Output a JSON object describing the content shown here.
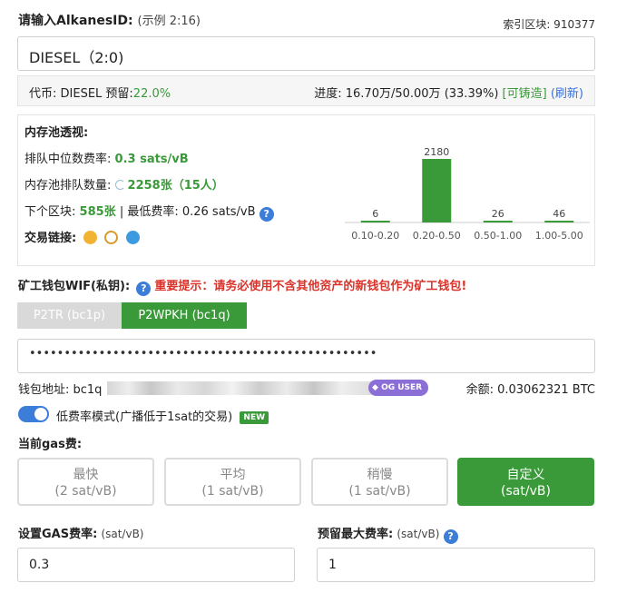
{
  "header": {
    "title": "请输入AlkanesID:",
    "example": "(示例 2:16)",
    "block_index": "索引区块: 910377"
  },
  "id_input": {
    "value": "DIESEL（2:0)"
  },
  "token": {
    "label": "代币: DIESEL 预留:",
    "reserve": "22.0%",
    "progress_label": "进度: 16.70万/50.00万 (33.39%)",
    "mintable": "[可铸造]",
    "refresh": "(刷新)"
  },
  "mempool": {
    "title": "内存池透视:",
    "median_label": "排队中位数费率:",
    "median_value": "0.3 sats/vB",
    "queue_label": "内存池排队数量:",
    "queue_value": "2258张（15人）",
    "next_block_label": "下个区块:",
    "next_block_value": "585张",
    "min_fee_label": "| 最低费率: 0.26 sats/vB",
    "links_label": "交易链接:"
  },
  "chart_data": {
    "type": "bar",
    "categories": [
      "0.10-0.20",
      "0.20-0.50",
      "0.50-1.00",
      "1.00-5.00"
    ],
    "values": [
      6,
      2180,
      26,
      46
    ],
    "ylim": [
      0,
      2180
    ],
    "bar_color": "#3a9a3a"
  },
  "wallet": {
    "wif_label": "矿工钱包WIF(私钥):",
    "warning": "重要提示：请务必使用不含其他资产的新钱包作为矿工钱包!",
    "tab_p2tr": "P2TR (bc1p)",
    "tab_p2wpkh": "P2WPKH (bc1q)",
    "wif_value": "••••••••••••••••••••••••••••••••••••••••••••••••••",
    "address_label": "钱包地址: bc1q",
    "og_badge": "OG USER",
    "balance": "余额: 0.03062321 BTC"
  },
  "low_fee": {
    "label": "低费率模式(广播低于1sat的交易)",
    "badge": "NEW"
  },
  "gas": {
    "title": "当前gas费:",
    "options": [
      {
        "name": "最快",
        "rate": "(2 sat/vB)"
      },
      {
        "name": "平均",
        "rate": "(1 sat/vB)"
      },
      {
        "name": "稍慢",
        "rate": "(1 sat/vB)"
      },
      {
        "name": "自定义",
        "rate": "(sat/vB)"
      }
    ],
    "rate_label": "设置GAS费率:",
    "rate_unit": "(sat/vB)",
    "rate_value": "0.3",
    "max_label": "预留最大费率:",
    "max_unit": "(sat/vB)",
    "max_value": "1"
  },
  "colors": {
    "accent_green": "#3a9a3a",
    "link_blue": "#3b6fd6",
    "warning_red": "#d9342b"
  }
}
